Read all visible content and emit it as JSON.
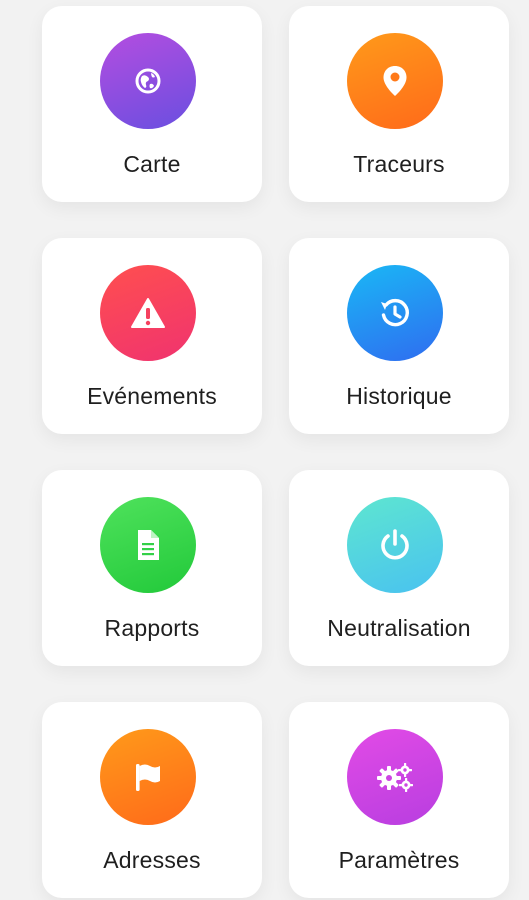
{
  "tiles": [
    {
      "label": "Carte",
      "icon": "globe-icon",
      "color": "#8a4ee0"
    },
    {
      "label": "Traceurs",
      "icon": "location-pin-icon",
      "color": "#ff7a1a"
    },
    {
      "label": "Evénements",
      "icon": "warning-icon",
      "color": "#f5415f"
    },
    {
      "label": "Historique",
      "icon": "history-icon",
      "color": "#2a8ff2"
    },
    {
      "label": "Rapports",
      "icon": "document-icon",
      "color": "#33d048"
    },
    {
      "label": "Neutralisation",
      "icon": "power-icon",
      "color": "#52d4e0"
    },
    {
      "label": "Adresses",
      "icon": "flag-icon",
      "color": "#ff7a1a"
    },
    {
      "label": "Paramètres",
      "icon": "gears-icon",
      "color": "#cd45e3"
    }
  ]
}
